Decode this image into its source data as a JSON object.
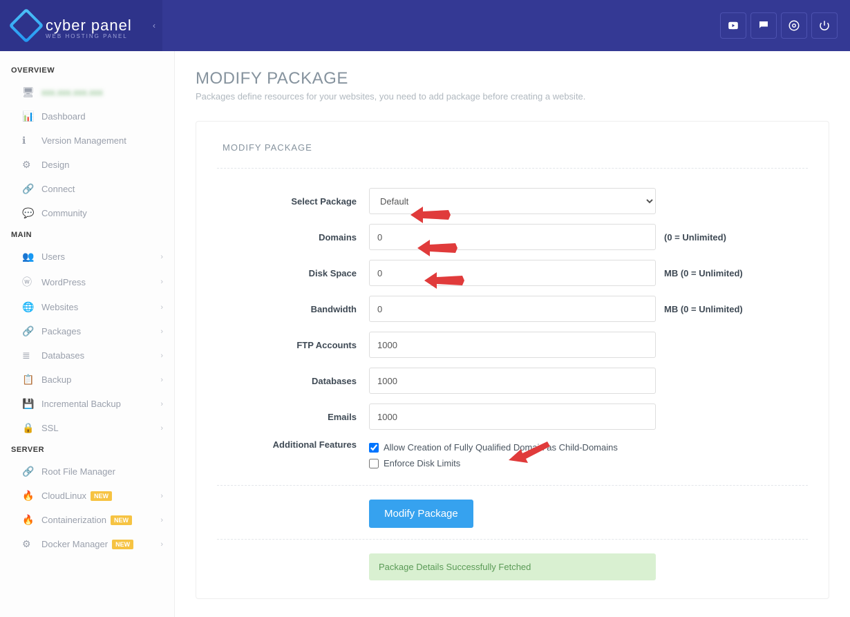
{
  "brand": {
    "name": "cyber panel",
    "sub": "WEB HOSTING PANEL"
  },
  "sidebar": {
    "overview_header": "OVERVIEW",
    "main_header": "MAIN",
    "server_header": "SERVER",
    "hostname": "xxx.xxx.xxx.xxx",
    "overview_items": [
      {
        "icon": "📊",
        "label": "Dashboard"
      },
      {
        "icon": "ℹ️",
        "label": "Version Management"
      },
      {
        "icon": "⚙",
        "label": "Design"
      },
      {
        "icon": "🔗",
        "label": "Connect"
      },
      {
        "icon": "💬",
        "label": "Community"
      }
    ],
    "main_items": [
      {
        "icon": "👥",
        "label": "Users",
        "chev": true
      },
      {
        "icon": "ⓦ",
        "label": "WordPress",
        "chev": true
      },
      {
        "icon": "🌐",
        "label": "Websites",
        "chev": true
      },
      {
        "icon": "🔗",
        "label": "Packages",
        "chev": true
      },
      {
        "icon": "≣",
        "label": "Databases",
        "chev": true
      },
      {
        "icon": "📋",
        "label": "Backup",
        "chev": true
      },
      {
        "icon": "💾",
        "label": "Incremental Backup",
        "chev": true
      },
      {
        "icon": "🔒",
        "label": "SSL",
        "chev": true
      }
    ],
    "server_items": [
      {
        "icon": "🔗",
        "label": "Root File Manager"
      },
      {
        "icon": "🔥",
        "label": "CloudLinux",
        "badge": "NEW",
        "chev": true
      },
      {
        "icon": "🔥",
        "label": "Containerization",
        "badge": "NEW",
        "chev": true
      },
      {
        "icon": "⚙",
        "label": "Docker Manager",
        "badge": "NEW",
        "chev": true
      }
    ]
  },
  "page": {
    "title": "MODIFY PACKAGE",
    "sub": "Packages define resources for your websites, you need to add package before creating a website.",
    "card_title": "MODIFY PACKAGE"
  },
  "form": {
    "select_package_label": "Select Package",
    "select_package_value": "Default",
    "domains": {
      "label": "Domains",
      "value": "0",
      "hint": "(0 = Unlimited)"
    },
    "disk": {
      "label": "Disk Space",
      "value": "0",
      "hint": "MB (0 = Unlimited)"
    },
    "bandwidth": {
      "label": "Bandwidth",
      "value": "0",
      "hint": "MB (0 = Unlimited)"
    },
    "ftp": {
      "label": "FTP Accounts",
      "value": "1000"
    },
    "db": {
      "label": "Databases",
      "value": "1000"
    },
    "emails": {
      "label": "Emails",
      "value": "1000"
    },
    "features_label": "Additional Features",
    "chk1": "Allow Creation of Fully Qualified Domain as Child-Domains",
    "chk2": "Enforce Disk Limits",
    "submit": "Modify Package",
    "alert": "Package Details Successfully Fetched"
  }
}
